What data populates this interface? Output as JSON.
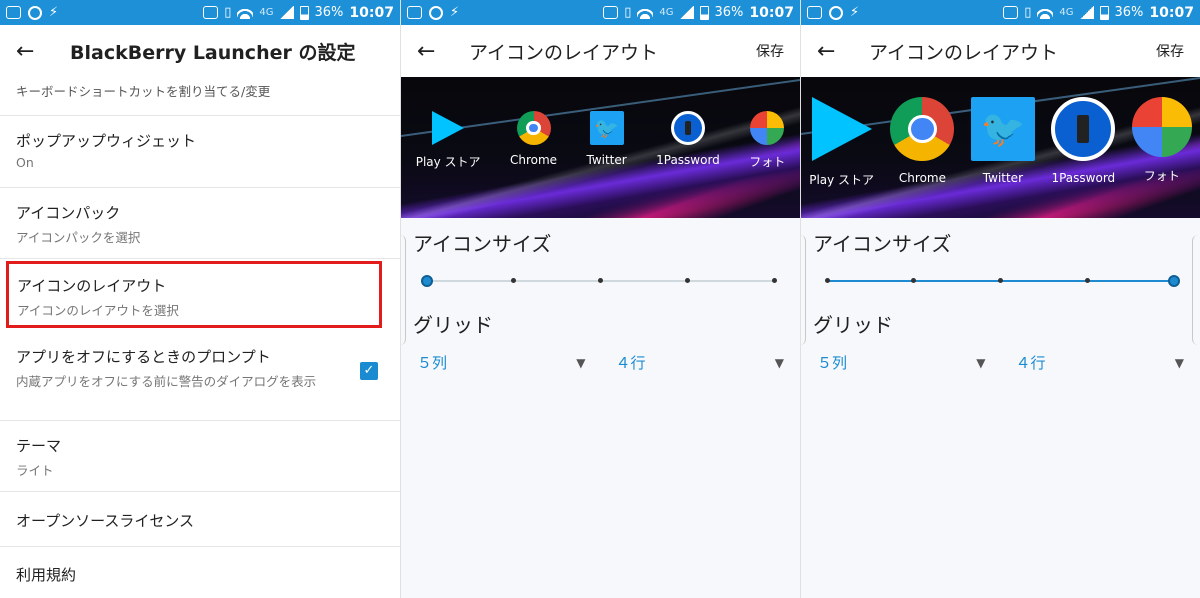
{
  "status_bar": {
    "network": "4G",
    "battery": "36%",
    "time": "10:07"
  },
  "screen1": {
    "title": "BlackBerry Launcher の設定",
    "items": [
      {
        "title": "",
        "subtitle": "キーボードショートカットを割り当てる/変更"
      },
      {
        "title": "ポップアップウィジェット",
        "subtitle": "On"
      },
      {
        "title": "アイコンパック",
        "subtitle": "アイコンパックを選択"
      },
      {
        "title": "アイコンのレイアウト",
        "subtitle": "アイコンのレイアウトを選択"
      },
      {
        "title": "アプリをオフにするときのプロンプト",
        "subtitle": "内蔵アプリをオフにする前に警告のダイアログを表示",
        "checked": true
      },
      {
        "title": "テーマ",
        "subtitle": "ライト"
      },
      {
        "title": "オープンソースライセンス",
        "subtitle": ""
      },
      {
        "title": "利用規約",
        "subtitle": ""
      }
    ]
  },
  "layout_screen": {
    "title": "アイコンのレイアウト",
    "save": "保存",
    "icon_size_label": "アイコンサイズ",
    "grid_label": "グリッド",
    "columns": "５列",
    "rows": "４行",
    "apps": [
      "Play ストア",
      "Chrome",
      "Twitter",
      "1Password",
      "フォト"
    ]
  },
  "screen2": {
    "icon_size_level": 0
  },
  "screen3": {
    "icon_size_level": 1
  },
  "colors": {
    "accent": "#1e8bd0",
    "status_bar": "#1e90d8",
    "highlight": "#e21b1b"
  }
}
